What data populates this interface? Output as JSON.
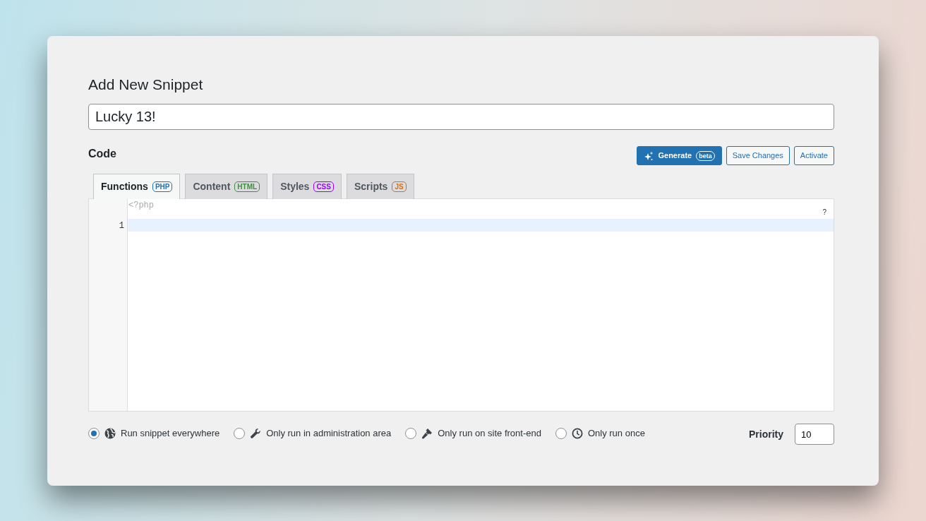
{
  "heading": "Add New Snippet",
  "title_field": {
    "value": "Lucky 13!"
  },
  "code_label": "Code",
  "buttons": [
    {
      "kind": "generate",
      "label": "Generate",
      "badge": "beta"
    },
    {
      "kind": "outline",
      "label": "Save Changes"
    },
    {
      "kind": "outline",
      "label": "Activate"
    }
  ],
  "tabs": [
    {
      "label": "Functions",
      "badge": "PHP",
      "color": "#2271b1",
      "selected": true
    },
    {
      "label": "Content",
      "badge": "HTML",
      "color": "#3e8e41",
      "selected": false
    },
    {
      "label": "Styles",
      "badge": "CSS",
      "color": "#9b00ff",
      "selected": false
    },
    {
      "label": "Scripts",
      "badge": "JS",
      "color": "#d46f15",
      "selected": false
    }
  ],
  "editor": {
    "prefix": "<?php",
    "help": "?",
    "lines": [
      {
        "number": "1",
        "active": true
      }
    ]
  },
  "scopes": [
    {
      "kind": "globe",
      "label": "Run snippet everywhere",
      "selected": true
    },
    {
      "kind": "wrench",
      "label": "Only run in administration area",
      "selected": false
    },
    {
      "kind": "brush",
      "label": "Only run on site front-end",
      "selected": false
    },
    {
      "kind": "clock",
      "label": "Only run once",
      "selected": false
    }
  ],
  "priority": {
    "label": "Priority",
    "value": "10"
  }
}
